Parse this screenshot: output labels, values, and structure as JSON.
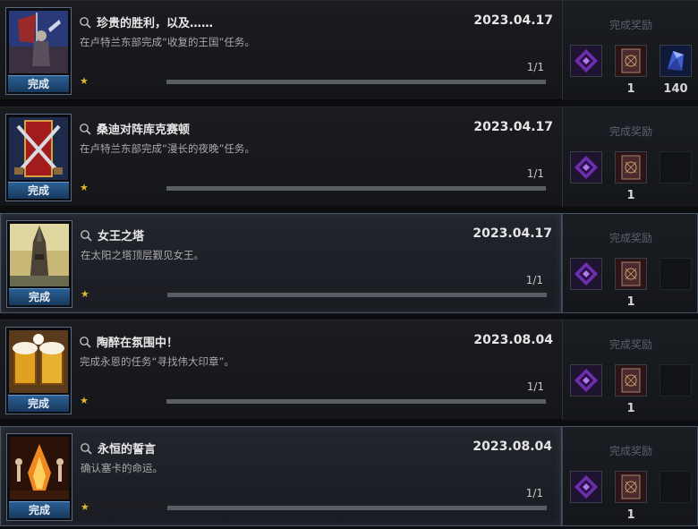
{
  "common": {
    "status_label": "完成",
    "rewards_label": "完成奖励"
  },
  "achievements": [
    {
      "title": "珍贵的胜利，以及……",
      "date": "2023.04.17",
      "description": "在卢特兰东部完成“收复的王国”任务。",
      "progress_text": "1/1",
      "progress": 1.0,
      "rewards": [
        {
          "icon": "purple-emblem-icon",
          "qty": ""
        },
        {
          "icon": "card-book-icon",
          "qty": "1"
        },
        {
          "icon": "blue-crystal-icon",
          "qty": "140"
        }
      ]
    },
    {
      "title": "桑迪对阵库克赛顿",
      "date": "2023.04.17",
      "description": "在卢特兰东部完成“漫长的夜晚”任务。",
      "progress_text": "1/1",
      "progress": 1.0,
      "rewards": [
        {
          "icon": "purple-emblem-icon",
          "qty": ""
        },
        {
          "icon": "card-book-icon",
          "qty": "1"
        },
        {
          "icon": "empty",
          "qty": ""
        }
      ]
    },
    {
      "title": "女王之塔",
      "date": "2023.04.17",
      "description": "在太阳之塔顶层觐见女王。",
      "progress_text": "1/1",
      "progress": 1.0,
      "rewards": [
        {
          "icon": "purple-emblem-icon",
          "qty": ""
        },
        {
          "icon": "card-book-icon",
          "qty": "1"
        },
        {
          "icon": "empty",
          "qty": ""
        }
      ]
    },
    {
      "title": "陶醉在氛围中！",
      "date": "2023.08.04",
      "description": "完成永恩的任务“寻找伟大印章”。",
      "progress_text": "1/1",
      "progress": 1.0,
      "rewards": [
        {
          "icon": "purple-emblem-icon",
          "qty": ""
        },
        {
          "icon": "card-book-icon",
          "qty": "1"
        },
        {
          "icon": "empty",
          "qty": ""
        }
      ]
    },
    {
      "title": "永恒的誓言",
      "date": "2023.08.04",
      "description": "确认塞卡的命运。",
      "progress_text": "1/1",
      "progress": 1.0,
      "rewards": [
        {
          "icon": "purple-emblem-icon",
          "qty": ""
        },
        {
          "icon": "card-book-icon",
          "qty": "1"
        },
        {
          "icon": "empty",
          "qty": ""
        }
      ]
    }
  ]
}
